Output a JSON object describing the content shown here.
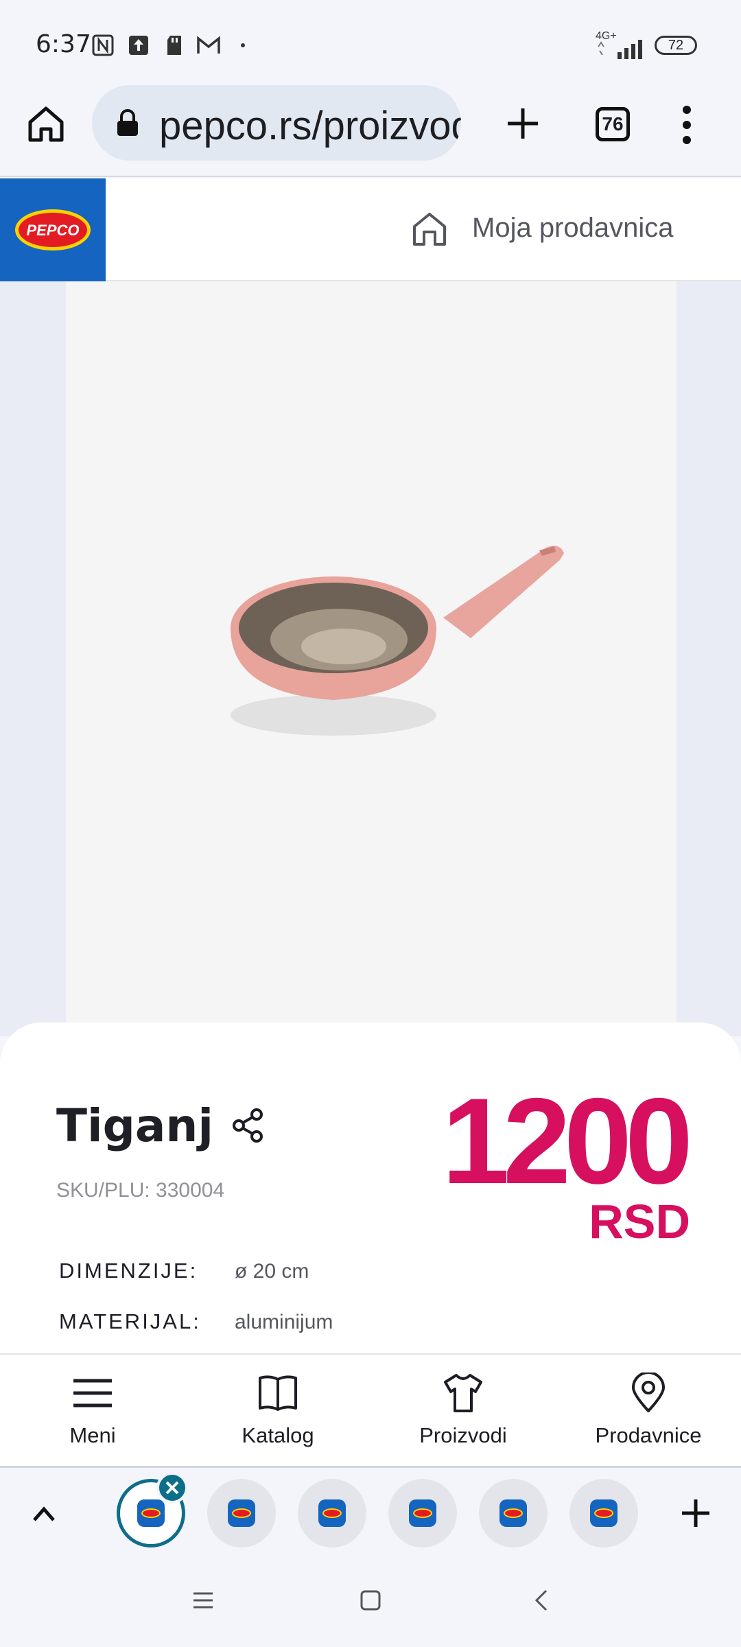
{
  "status_bar": {
    "time": "6:37",
    "network": "4G+",
    "battery": "72",
    "icons": [
      "nfc-icon",
      "upload-icon",
      "sd-card-icon",
      "gmail-icon",
      "dot-icon",
      "signal-icon",
      "battery-icon"
    ]
  },
  "browser": {
    "url": "pepco.rs/proizvodi",
    "tab_count": "76",
    "icons": [
      "home-icon",
      "lock-icon",
      "new-tab-icon",
      "tab-switcher-icon",
      "more-menu-icon"
    ]
  },
  "site_header": {
    "logo_text": "PEPCO",
    "store_label": "Moja prodavnica"
  },
  "product": {
    "name": "Tiganj",
    "sku": "SKU/PLU: 330004",
    "price": "1200",
    "currency": "RSD",
    "specs": [
      {
        "label": "DIMENZIJE:",
        "value": "ø 20 cm"
      },
      {
        "label": "MATERIJAL:",
        "value": "aluminijum"
      }
    ]
  },
  "site_nav": {
    "items": [
      {
        "label": "Meni",
        "icon": "menu-icon"
      },
      {
        "label": "Katalog",
        "icon": "book-icon"
      },
      {
        "label": "Proizvodi",
        "icon": "tshirt-icon"
      },
      {
        "label": "Prodavnice",
        "icon": "location-pin-icon"
      }
    ]
  },
  "tab_strip": {
    "tabs_visible": 6,
    "favicon_text": "PEPCO"
  },
  "colors": {
    "brand_blue": "#1565c0",
    "price_pink": "#d6105e",
    "active_tab_ring": "#0d6e8a"
  }
}
